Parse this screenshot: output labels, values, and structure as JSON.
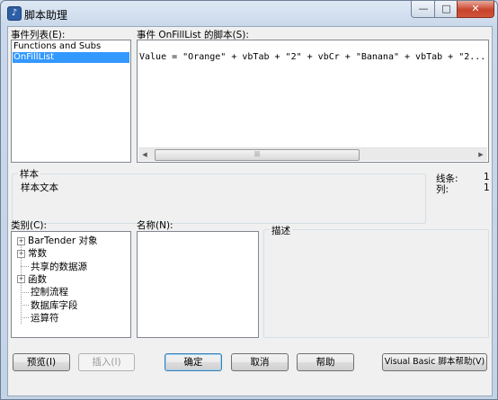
{
  "window": {
    "title": "脚本助理",
    "app_icon_glyph": "♪",
    "minimize_glyph": "—",
    "maximize_glyph": "□",
    "close_glyph": "✕"
  },
  "events_list": {
    "label": "事件列表(E):",
    "items": [
      "Functions and Subs",
      "OnFillList"
    ],
    "selected_index": 1
  },
  "script_editor": {
    "label": "事件 OnFillList 的脚本(S):",
    "code_line": "Value = \"Orange\" + vbTab + \"2\" + vbCr + \"Banana\" + vbTab + \"2..."
  },
  "sample": {
    "group_label": "样本",
    "text": "样本文本",
    "line_label": "线条:",
    "line_value": "1",
    "column_label": "列:",
    "column_value": "1"
  },
  "category": {
    "label": "类别(C):",
    "items": [
      {
        "label": "BarTender 对象",
        "expandable": true
      },
      {
        "label": "常数",
        "expandable": true
      },
      {
        "label": "共享的数据源",
        "expandable": false
      },
      {
        "label": "函数",
        "expandable": true
      },
      {
        "label": "控制流程",
        "expandable": false
      },
      {
        "label": "数据库字段",
        "expandable": false
      },
      {
        "label": "运算符",
        "expandable": false
      }
    ]
  },
  "name_list": {
    "label": "名称(N):"
  },
  "description": {
    "label": "描述"
  },
  "buttons": {
    "preview": "预览(I)",
    "insert": "插入(I)",
    "ok": "确定",
    "cancel": "取消",
    "help": "帮助",
    "vb_help": "Visual Basic 脚本帮助(V)"
  },
  "colors": {
    "selection": "#3399ff",
    "close_button": "#c7442c"
  }
}
